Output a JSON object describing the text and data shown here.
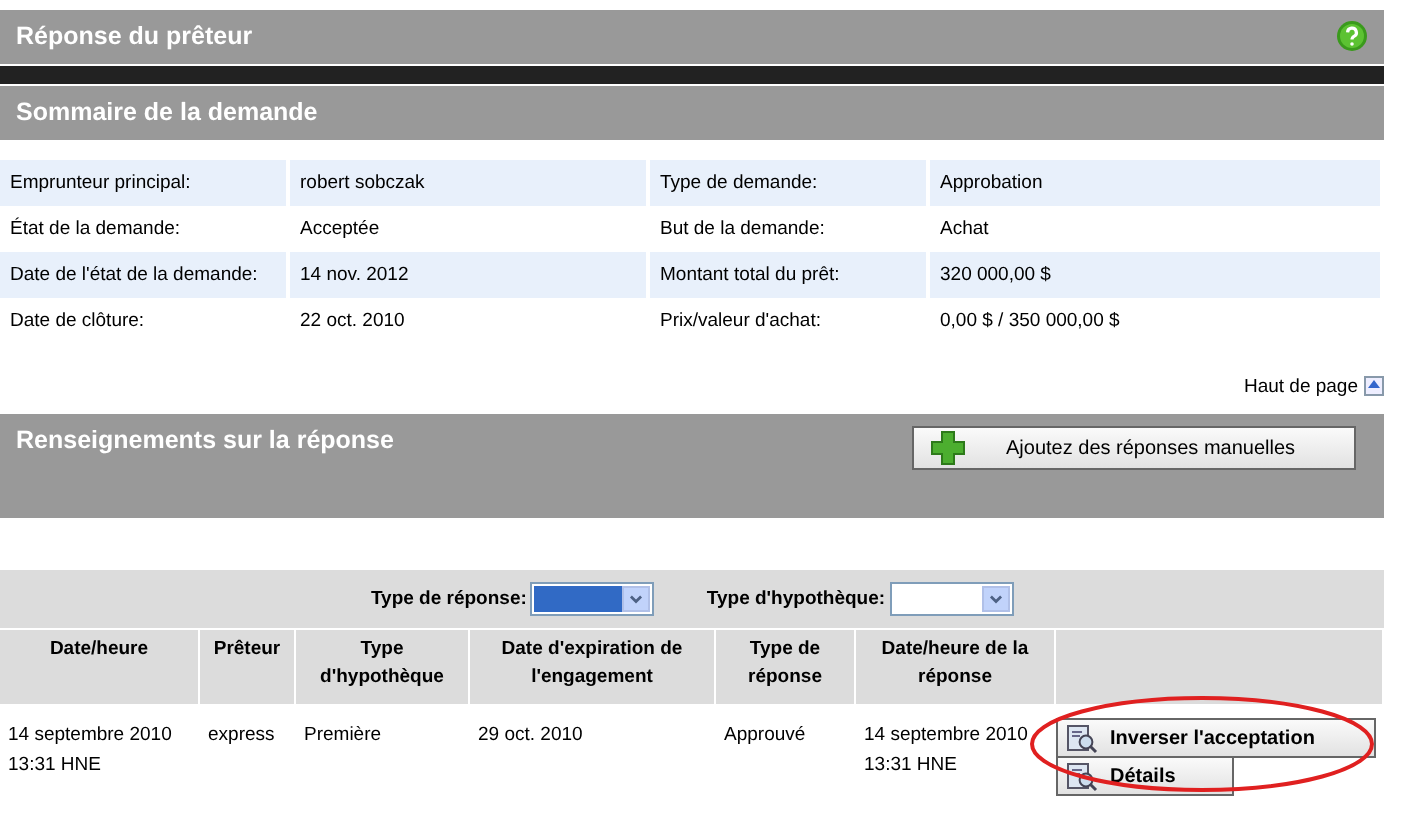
{
  "page_header": {
    "title": "Réponse du prêteur"
  },
  "summary": {
    "title": "Sommaire de la demande",
    "rows": [
      {
        "label_1": "Emprunteur principal:",
        "value_1": "robert sobczak",
        "label_2": "Type de demande:",
        "value_2": "Approbation"
      },
      {
        "label_1": "État de la demande:",
        "value_1": "Acceptée",
        "label_2": "But de la demande:",
        "value_2": "Achat"
      },
      {
        "label_1": "Date de l'état de la demande:",
        "value_1": "14 nov. 2012",
        "label_2": "Montant total du prêt:",
        "value_2": "320 000,00 $"
      },
      {
        "label_1": "Date de clôture:",
        "value_1": "22 oct. 2010",
        "label_2": "Prix/valeur d'achat:",
        "value_2": "0,00 $ / 350 000,00 $"
      }
    ]
  },
  "top_link": "Haut de page",
  "responses": {
    "title": "Renseignements sur la réponse",
    "add_button": "Ajoutez des réponses manuelles",
    "filters": [
      {
        "label": "Type de réponse:",
        "highlighted": true
      },
      {
        "label": "Type d'hypothèque:",
        "highlighted": false
      }
    ],
    "columns": [
      "Date/heure",
      "Prêteur",
      "Type d'hypothèque",
      "Date d'expiration de l'engagement",
      "Type de réponse",
      "Date/heure de la réponse"
    ],
    "rows": [
      {
        "cells": [
          "14 septembre 2010 13:31 HNE",
          "express",
          "Première",
          "29 oct. 2010",
          "Approuvé",
          "14 septembre 2010 13:31 HNE"
        ],
        "actions": [
          {
            "label": "Inverser l'acceptation",
            "circled": true
          },
          {
            "label": "Détails",
            "circled": false
          }
        ]
      }
    ]
  }
}
